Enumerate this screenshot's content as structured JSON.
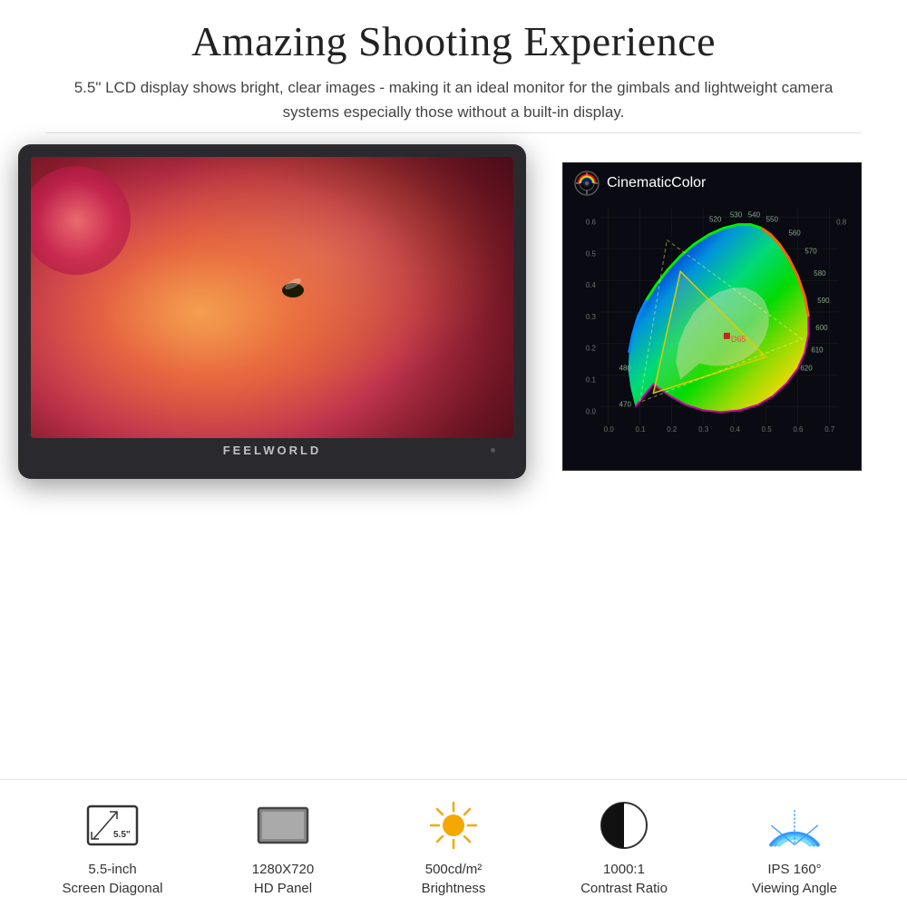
{
  "header": {
    "title": "Amazing Shooting Experience",
    "subtitle": "5.5\" LCD display shows bright, clear images - making it an ideal monitor for the gimbals and lightweight camera systems especially those without a built-in display."
  },
  "monitor": {
    "brand": "FEELWORLD"
  },
  "chart": {
    "title": "CinematicColor",
    "logo_alt": "cinematic-color-logo"
  },
  "specs": [
    {
      "id": "screen-diagonal",
      "value": "5.5\"",
      "label1": "5.5-inch",
      "label2": "Screen Diagonal"
    },
    {
      "id": "hd-panel",
      "value": "",
      "label1": "1280X720",
      "label2": "HD Panel"
    },
    {
      "id": "brightness",
      "value": "",
      "label1": "500cd/m²",
      "label2": "Brightness"
    },
    {
      "id": "contrast",
      "value": "",
      "label1": "1000:1",
      "label2": "Contrast Ratio"
    },
    {
      "id": "viewing-angle",
      "value": "",
      "label1": "IPS 160°",
      "label2": "Viewing Angle"
    }
  ]
}
